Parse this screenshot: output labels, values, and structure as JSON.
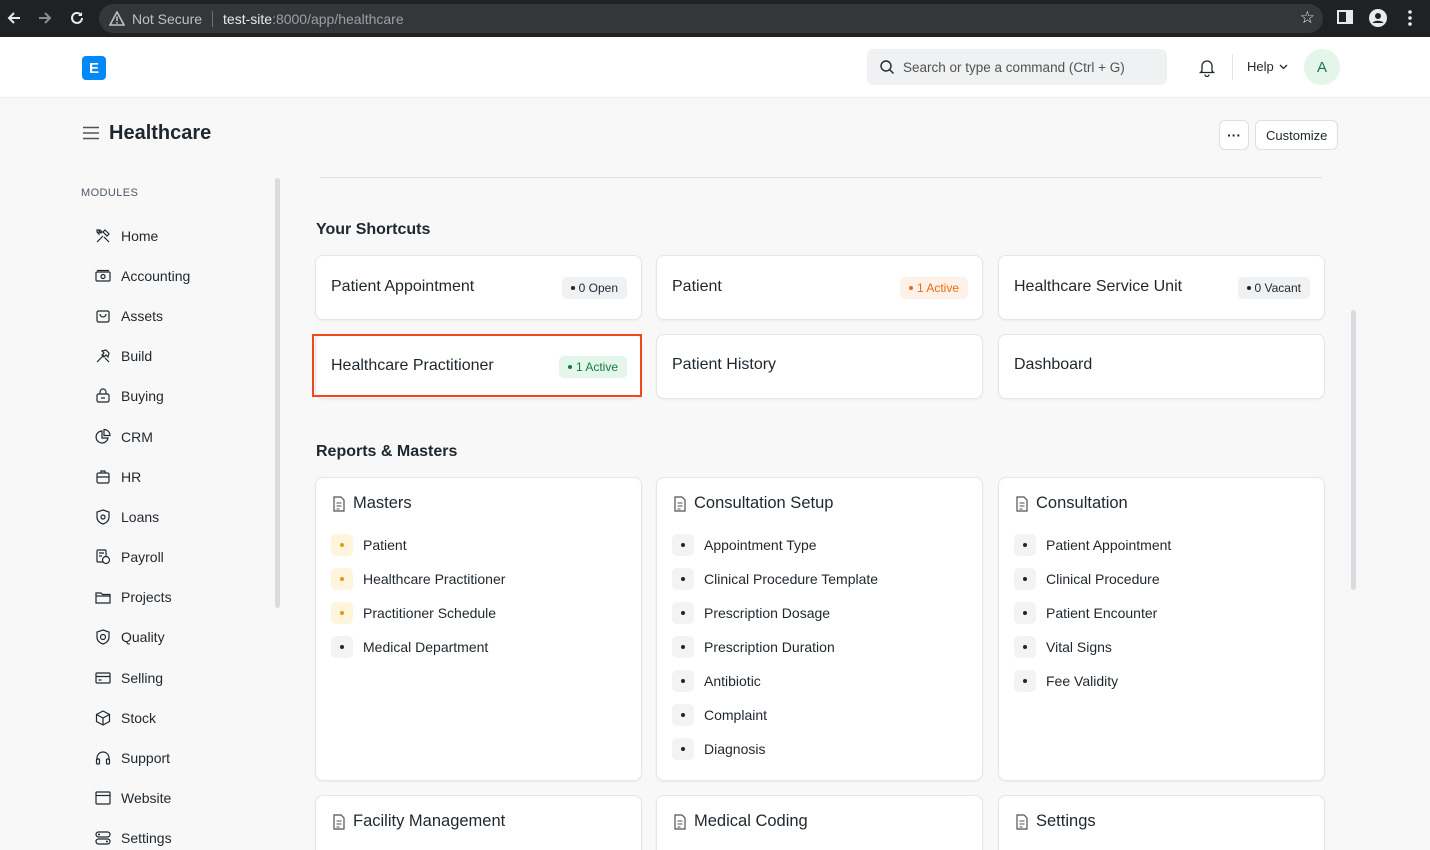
{
  "browser": {
    "security_label": "Not Secure",
    "url_host": "test-site",
    "url_rest": ":8000/app/healthcare"
  },
  "navbar": {
    "logo_letter": "E",
    "search_placeholder": "Search or type a command (Ctrl + G)",
    "help_label": "Help",
    "avatar_letter": "A"
  },
  "page": {
    "title": "Healthcare",
    "more_label": "···",
    "customize_label": "Customize"
  },
  "sidebar": {
    "heading": "MODULES",
    "items": [
      {
        "label": "Home",
        "icon": "tools-icon"
      },
      {
        "label": "Accounting",
        "icon": "money-icon"
      },
      {
        "label": "Assets",
        "icon": "bag-icon"
      },
      {
        "label": "Build",
        "icon": "hammer-icon"
      },
      {
        "label": "Buying",
        "icon": "basket-icon"
      },
      {
        "label": "CRM",
        "icon": "pie-icon"
      },
      {
        "label": "HR",
        "icon": "briefcase-icon"
      },
      {
        "label": "Loans",
        "icon": "shield-money-icon"
      },
      {
        "label": "Payroll",
        "icon": "receipt-icon"
      },
      {
        "label": "Projects",
        "icon": "folder-icon"
      },
      {
        "label": "Quality",
        "icon": "badge-icon"
      },
      {
        "label": "Selling",
        "icon": "card-icon"
      },
      {
        "label": "Stock",
        "icon": "box-icon"
      },
      {
        "label": "Support",
        "icon": "headset-icon"
      },
      {
        "label": "Website",
        "icon": "browser-icon"
      },
      {
        "label": "Settings",
        "icon": "settings-icon"
      }
    ]
  },
  "shortcuts": {
    "title": "Your Shortcuts",
    "items": [
      {
        "label": "Patient Appointment",
        "badge": "0 Open",
        "badge_color": "#1f272e"
      },
      {
        "label": "Patient",
        "badge": "1 Active",
        "badge_color": "#e86c13"
      },
      {
        "label": "Healthcare Service Unit",
        "badge": "0 Vacant",
        "badge_color": "#1f272e"
      },
      {
        "label": "Healthcare Practitioner",
        "badge": "1 Active",
        "badge_color": "#16794c"
      },
      {
        "label": "Patient History",
        "badge": ""
      },
      {
        "label": "Dashboard",
        "badge": ""
      }
    ]
  },
  "reports": {
    "title": "Reports & Masters",
    "cards": [
      {
        "title": "Masters",
        "links": [
          "Patient",
          "Healthcare Practitioner",
          "Practitioner Schedule",
          "Medical Department"
        ]
      },
      {
        "title": "Consultation Setup",
        "links": [
          "Appointment Type",
          "Clinical Procedure Template",
          "Prescription Dosage",
          "Prescription Duration",
          "Antibiotic",
          "Complaint",
          "Diagnosis"
        ]
      },
      {
        "title": "Consultation",
        "links": [
          "Patient Appointment",
          "Clinical Procedure",
          "Patient Encounter",
          "Vital Signs",
          "Fee Validity"
        ]
      },
      {
        "title": "Facility Management",
        "links": []
      },
      {
        "title": "Medical Coding",
        "links": []
      },
      {
        "title": "Settings",
        "links": []
      }
    ]
  }
}
